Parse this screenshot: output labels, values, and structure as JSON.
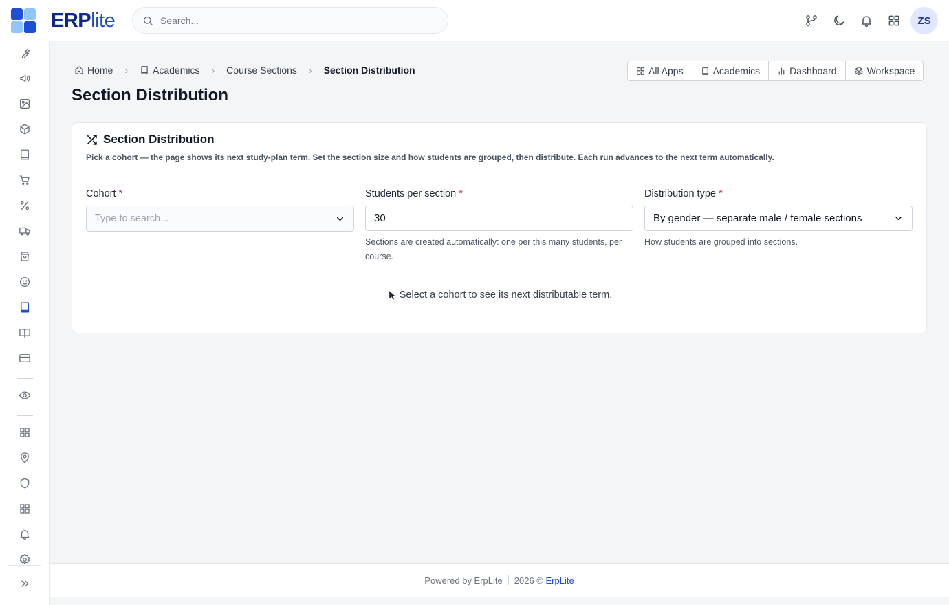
{
  "app": {
    "brand_bold": "ERP",
    "brand_light": "lite",
    "logo_colors": [
      "#1d4ed8",
      "#93c5fd",
      "#93c5fd",
      "#1d4ed8"
    ]
  },
  "search": {
    "placeholder": "Search..."
  },
  "topbar": {
    "icons": [
      "git-branch-icon",
      "moon-icon",
      "bell-icon",
      "apps-grid-icon"
    ],
    "avatar": "ZS"
  },
  "sidebar": {
    "items": [
      "wrench-icon",
      "megaphone-icon",
      "image-icon",
      "box-icon",
      "book-icon",
      "cart-icon",
      "percent-icon",
      "truck-icon",
      "package-icon",
      "smile-icon",
      "book-open-active-icon",
      "book-open-icon",
      "card-icon",
      "eye-icon",
      "grid-icon",
      "map-pin-icon",
      "shield-icon",
      "grid-icon",
      "bell-icon",
      "settings-icon"
    ],
    "active": "book-open-active-icon",
    "expand": "chevrons-right-icon"
  },
  "breadcrumb": [
    {
      "label": "Home",
      "icon": "home-icon"
    },
    {
      "label": "Academics",
      "icon": "book-icon"
    },
    {
      "label": "Course Sections"
    },
    {
      "label": "Section Distribution"
    }
  ],
  "page": {
    "title": "Section Distribution"
  },
  "quick_links": [
    {
      "label": "All Apps",
      "icon": "grid-icon"
    },
    {
      "label": "Academics",
      "icon": "book-icon"
    },
    {
      "label": "Dashboard",
      "icon": "bar-chart-icon"
    },
    {
      "label": "Workspace",
      "icon": "layers-icon"
    }
  ],
  "card": {
    "title": "Section Distribution",
    "description": "Pick a cohort — the page shows its next study-plan term. Set the section size and how students are grouped, then distribute. Each run advances to the next term automatically."
  },
  "form": {
    "cohort": {
      "label": "Cohort",
      "required": "*",
      "placeholder": "Type to search..."
    },
    "students": {
      "label": "Students per section",
      "required": "*",
      "value": "30",
      "help": "Sections are created automatically: one per this many students, per course."
    },
    "distribution": {
      "label": "Distribution type",
      "required": "*",
      "value": "By gender — separate male / female sections",
      "help": "How students are grouped into sections."
    }
  },
  "empty_state": {
    "text": "Select a cohort to see its next distributable term."
  },
  "footer": {
    "powered": "Powered by ErpLite",
    "year": "2026 ©",
    "link": "ErpLite"
  }
}
